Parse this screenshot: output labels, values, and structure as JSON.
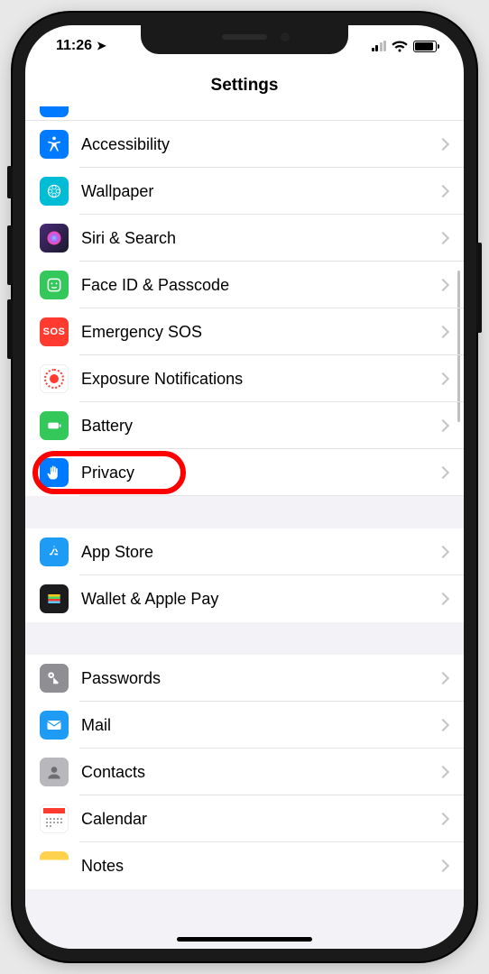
{
  "status": {
    "time": "11:26",
    "location_glyph": "➤"
  },
  "nav": {
    "title": "Settings"
  },
  "sections": [
    {
      "partial_top": true,
      "rows": [
        {
          "id": "accessibility",
          "label": "Accessibility",
          "icon": "accessibility-icon",
          "color": "ic-blue"
        },
        {
          "id": "wallpaper",
          "label": "Wallpaper",
          "icon": "wallpaper-icon",
          "color": "ic-teal"
        },
        {
          "id": "siri-search",
          "label": "Siri & Search",
          "icon": "siri-icon",
          "color": "ic-black"
        },
        {
          "id": "face-id-passcode",
          "label": "Face ID & Passcode",
          "icon": "faceid-icon",
          "color": "ic-green"
        },
        {
          "id": "emergency-sos",
          "label": "Emergency SOS",
          "icon": "sos-icon",
          "color": "ic-red"
        },
        {
          "id": "exposure-notifications",
          "label": "Exposure Notifications",
          "icon": "exposure-icon",
          "color": "ic-white"
        },
        {
          "id": "battery",
          "label": "Battery",
          "icon": "battery-icon",
          "color": "ic-greenB"
        },
        {
          "id": "privacy",
          "label": "Privacy",
          "icon": "privacy-icon",
          "color": "ic-blue",
          "highlighted": true
        }
      ]
    },
    {
      "rows": [
        {
          "id": "app-store",
          "label": "App Store",
          "icon": "appstore-icon",
          "color": "ic-appstore"
        },
        {
          "id": "wallet-apple-pay",
          "label": "Wallet & Apple Pay",
          "icon": "wallet-icon",
          "color": "ic-wallet"
        }
      ]
    },
    {
      "rows": [
        {
          "id": "passwords",
          "label": "Passwords",
          "icon": "key-icon",
          "color": "ic-grey"
        },
        {
          "id": "mail",
          "label": "Mail",
          "icon": "mail-icon",
          "color": "ic-mail"
        },
        {
          "id": "contacts",
          "label": "Contacts",
          "icon": "contacts-icon",
          "color": "ic-contacts"
        },
        {
          "id": "calendar",
          "label": "Calendar",
          "icon": "calendar-icon",
          "color": "ic-cal"
        },
        {
          "id": "notes",
          "label": "Notes",
          "icon": "notes-icon",
          "color": "ic-notes"
        }
      ]
    }
  ],
  "annotation": {
    "highlight_target": "privacy",
    "highlight_color": "#ff0000"
  }
}
